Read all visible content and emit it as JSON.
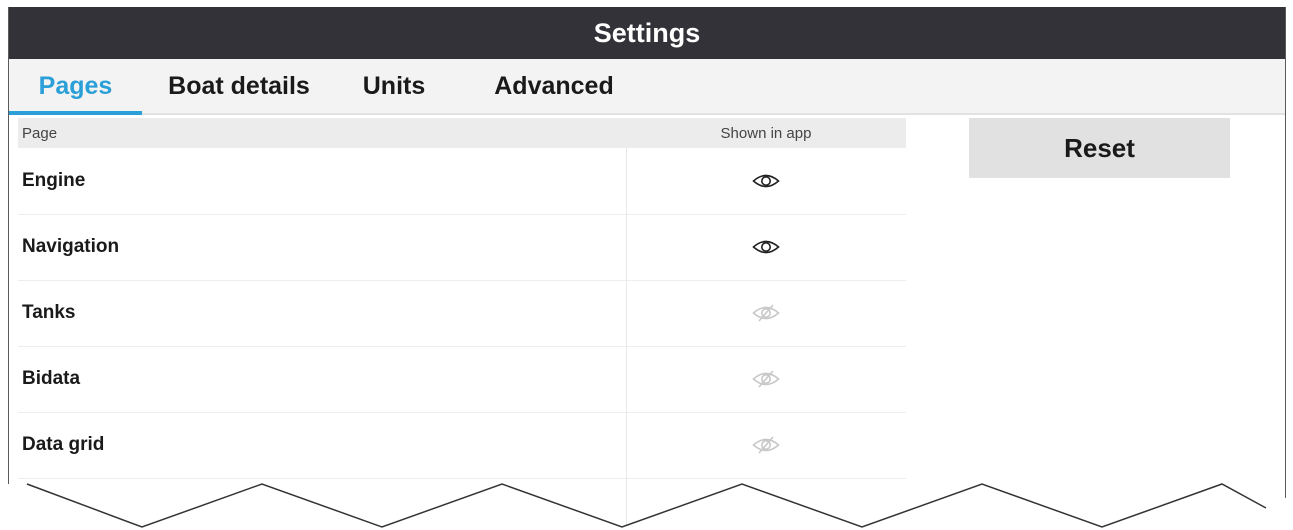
{
  "window": {
    "title": "Settings"
  },
  "tabs": [
    {
      "label": "Pages",
      "active": true
    },
    {
      "label": "Boat details",
      "active": false
    },
    {
      "label": "Units",
      "active": false
    },
    {
      "label": "Advanced",
      "active": false
    }
  ],
  "table": {
    "headers": {
      "page": "Page",
      "shown": "Shown in app"
    },
    "rows": [
      {
        "name": "Engine",
        "shown": true,
        "icon": "eye-icon"
      },
      {
        "name": "Navigation",
        "shown": true,
        "icon": "eye-icon"
      },
      {
        "name": "Tanks",
        "shown": false,
        "icon": "eye-off-icon"
      },
      {
        "name": "Bidata",
        "shown": false,
        "icon": "eye-off-icon"
      },
      {
        "name": "Data grid",
        "shown": false,
        "icon": "eye-off-icon"
      }
    ]
  },
  "actions": {
    "reset_label": "Reset"
  },
  "colors": {
    "titlebar": "#323238",
    "accent": "#2a9fd8",
    "visible_icon": "#222222",
    "hidden_icon": "#c8c8c8"
  }
}
